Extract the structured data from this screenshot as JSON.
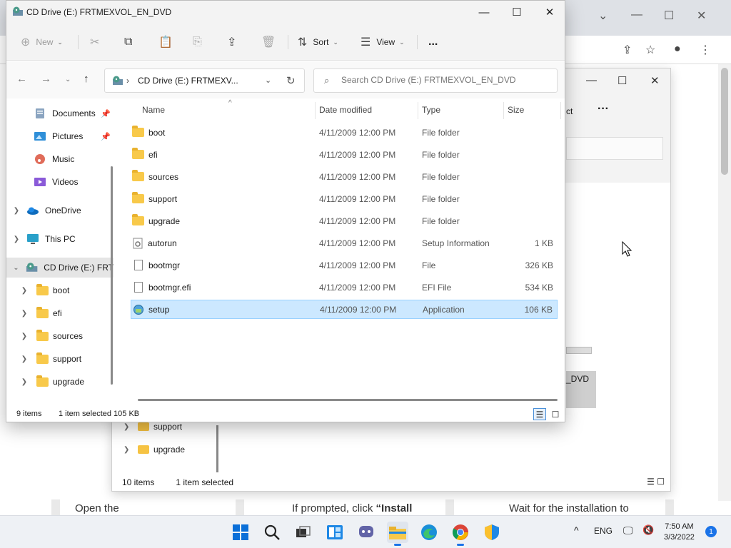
{
  "window": {
    "title": "CD Drive (E:) FRTMEXVOL_EN_DVD"
  },
  "toolbar": {
    "new_label": "New",
    "sort_label": "Sort",
    "view_label": "View",
    "more_label": "..."
  },
  "address": {
    "path": "CD Drive (E:) FRTMEXV...",
    "search_placeholder": "Search CD Drive (E:) FRTMEXVOL_EN_DVD"
  },
  "nav": {
    "items": [
      {
        "label": "Documents",
        "icon": "documents-icon",
        "pinned": true
      },
      {
        "label": "Pictures",
        "icon": "pictures-icon",
        "pinned": true
      },
      {
        "label": "Music",
        "icon": "music-icon"
      },
      {
        "label": "Videos",
        "icon": "videos-icon"
      },
      {
        "label": "OneDrive",
        "icon": "onedrive-icon"
      },
      {
        "label": "This PC",
        "icon": "this-pc-icon"
      },
      {
        "label": "CD Drive (E:) FRT",
        "icon": "cd-drive-icon"
      },
      {
        "label": "boot",
        "icon": "folder-icon"
      },
      {
        "label": "efi",
        "icon": "folder-icon"
      },
      {
        "label": "sources",
        "icon": "folder-icon"
      },
      {
        "label": "support",
        "icon": "folder-icon"
      },
      {
        "label": "upgrade",
        "icon": "folder-icon"
      }
    ]
  },
  "columns": {
    "name": "Name",
    "date": "Date modified",
    "type": "Type",
    "size": "Size"
  },
  "files": [
    {
      "name": "boot",
      "date": "4/11/2009 12:00 PM",
      "type": "File folder",
      "size": "",
      "icon": "folder-icon"
    },
    {
      "name": "efi",
      "date": "4/11/2009 12:00 PM",
      "type": "File folder",
      "size": "",
      "icon": "folder-icon"
    },
    {
      "name": "sources",
      "date": "4/11/2009 12:00 PM",
      "type": "File folder",
      "size": "",
      "icon": "folder-icon"
    },
    {
      "name": "support",
      "date": "4/11/2009 12:00 PM",
      "type": "File folder",
      "size": "",
      "icon": "folder-icon"
    },
    {
      "name": "upgrade",
      "date": "4/11/2009 12:00 PM",
      "type": "File folder",
      "size": "",
      "icon": "folder-icon"
    },
    {
      "name": "autorun",
      "date": "4/11/2009 12:00 PM",
      "type": "Setup Information",
      "size": "1 KB",
      "icon": "setup-info-icon"
    },
    {
      "name": "bootmgr",
      "date": "4/11/2009 12:00 PM",
      "type": "File",
      "size": "326 KB",
      "icon": "file-icon"
    },
    {
      "name": "bootmgr.efi",
      "date": "4/11/2009 12:00 PM",
      "type": "EFI File",
      "size": "534 KB",
      "icon": "file-icon"
    },
    {
      "name": "setup",
      "date": "4/11/2009 12:00 PM",
      "type": "Application",
      "size": "106 KB",
      "icon": "setup-app-icon",
      "selected": true
    }
  ],
  "status": {
    "count": "9 items",
    "selection": "1 item selected  105 KB"
  },
  "explorer2": {
    "frag_text": "ct",
    "frag_text2": "_DVD",
    "nav_items": [
      "support",
      "upgrade"
    ],
    "status_count": "10 items",
    "status_selection": "1 item selected"
  },
  "background_page": {
    "col1": "Open the",
    "col2_prefix": "If prompted, click ",
    "col2_bold": "“Install",
    "col3": "Wait for the installation to"
  },
  "taskbar": {
    "lang": "ENG",
    "time": "7:50 AM",
    "date": "3/3/2022",
    "notifications": "1"
  },
  "colors": {
    "accent": "#1a73e8",
    "selection_bg": "#cce8ff",
    "selection_border": "#99d1ff",
    "folder": "#f8c94a"
  }
}
